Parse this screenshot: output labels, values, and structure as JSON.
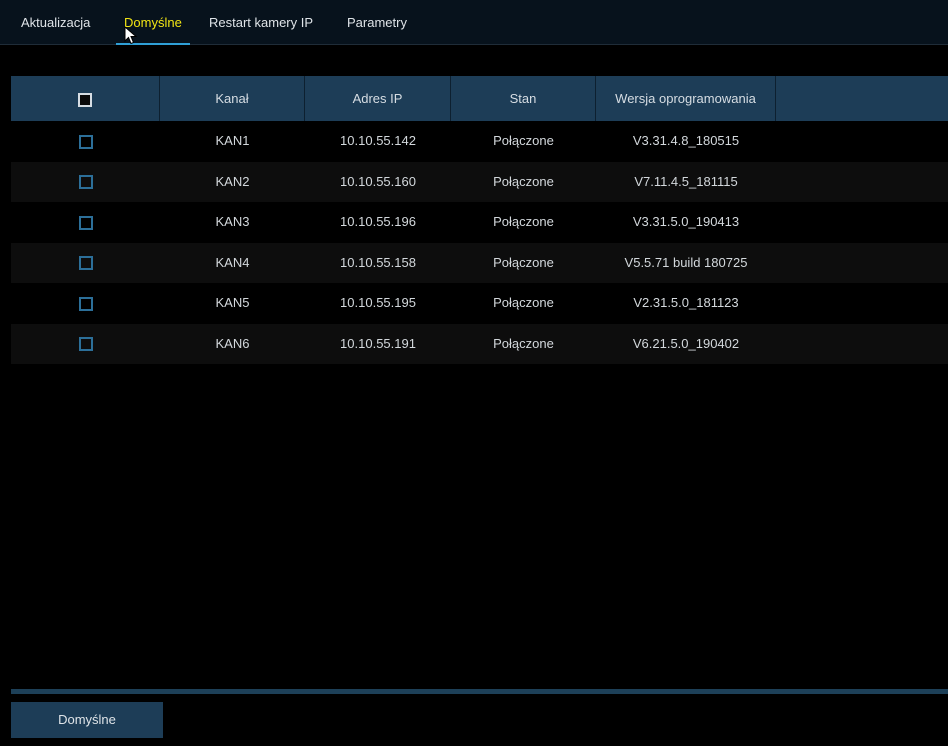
{
  "tabs": [
    {
      "label": "Aktualizacja",
      "active": false
    },
    {
      "label": "Domyślne",
      "active": true
    },
    {
      "label": "Restart kamery IP",
      "active": false
    },
    {
      "label": "Parametry",
      "active": false
    }
  ],
  "table": {
    "headers": [
      "Kanał",
      "Adres IP",
      "Stan",
      "Wersja oprogramowania"
    ],
    "rows": [
      {
        "channel": "KAN1",
        "ip": "10.10.55.142",
        "status": "Połączone",
        "version": "V3.31.4.8_180515"
      },
      {
        "channel": "KAN2",
        "ip": "10.10.55.160",
        "status": "Połączone",
        "version": "V7.11.4.5_181115"
      },
      {
        "channel": "KAN3",
        "ip": "10.10.55.196",
        "status": "Połączone",
        "version": "V3.31.5.0_190413"
      },
      {
        "channel": "KAN4",
        "ip": "10.10.55.158",
        "status": "Połączone",
        "version": "V5.5.71 build 180725"
      },
      {
        "channel": "KAN5",
        "ip": "10.10.55.195",
        "status": "Połączone",
        "version": "V2.31.5.0_181123"
      },
      {
        "channel": "KAN6",
        "ip": "10.10.55.191",
        "status": "Połączone",
        "version": "V6.21.5.0_190402"
      }
    ]
  },
  "footer": {
    "default_button_label": "Domyślne"
  },
  "colors": {
    "active_tab": "#f2e514",
    "tab_underline": "#2f9fd6",
    "header_bg": "#1d3d57",
    "checkbox_border": "#2c6f99"
  }
}
